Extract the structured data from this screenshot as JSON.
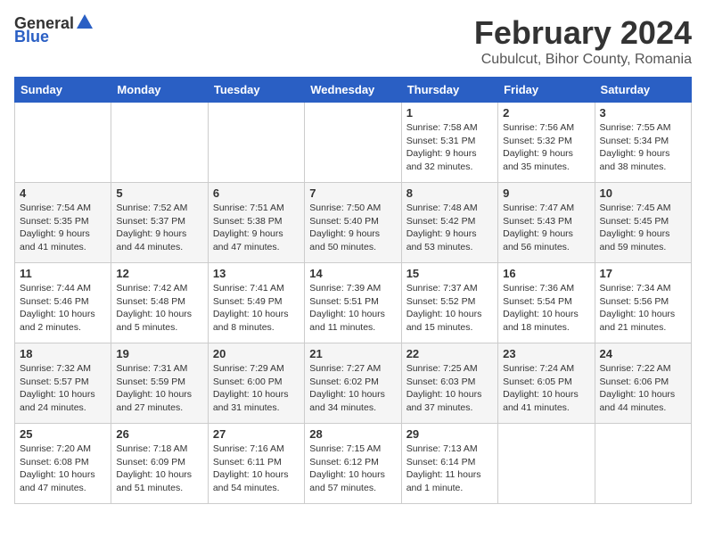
{
  "logo": {
    "general": "General",
    "blue": "Blue"
  },
  "title": "February 2024",
  "subtitle": "Cubulcut, Bihor County, Romania",
  "days_of_week": [
    "Sunday",
    "Monday",
    "Tuesday",
    "Wednesday",
    "Thursday",
    "Friday",
    "Saturday"
  ],
  "weeks": [
    [
      {
        "day": "",
        "info": ""
      },
      {
        "day": "",
        "info": ""
      },
      {
        "day": "",
        "info": ""
      },
      {
        "day": "",
        "info": ""
      },
      {
        "day": "1",
        "info": "Sunrise: 7:58 AM\nSunset: 5:31 PM\nDaylight: 9 hours\nand 32 minutes."
      },
      {
        "day": "2",
        "info": "Sunrise: 7:56 AM\nSunset: 5:32 PM\nDaylight: 9 hours\nand 35 minutes."
      },
      {
        "day": "3",
        "info": "Sunrise: 7:55 AM\nSunset: 5:34 PM\nDaylight: 9 hours\nand 38 minutes."
      }
    ],
    [
      {
        "day": "4",
        "info": "Sunrise: 7:54 AM\nSunset: 5:35 PM\nDaylight: 9 hours\nand 41 minutes."
      },
      {
        "day": "5",
        "info": "Sunrise: 7:52 AM\nSunset: 5:37 PM\nDaylight: 9 hours\nand 44 minutes."
      },
      {
        "day": "6",
        "info": "Sunrise: 7:51 AM\nSunset: 5:38 PM\nDaylight: 9 hours\nand 47 minutes."
      },
      {
        "day": "7",
        "info": "Sunrise: 7:50 AM\nSunset: 5:40 PM\nDaylight: 9 hours\nand 50 minutes."
      },
      {
        "day": "8",
        "info": "Sunrise: 7:48 AM\nSunset: 5:42 PM\nDaylight: 9 hours\nand 53 minutes."
      },
      {
        "day": "9",
        "info": "Sunrise: 7:47 AM\nSunset: 5:43 PM\nDaylight: 9 hours\nand 56 minutes."
      },
      {
        "day": "10",
        "info": "Sunrise: 7:45 AM\nSunset: 5:45 PM\nDaylight: 9 hours\nand 59 minutes."
      }
    ],
    [
      {
        "day": "11",
        "info": "Sunrise: 7:44 AM\nSunset: 5:46 PM\nDaylight: 10 hours\nand 2 minutes."
      },
      {
        "day": "12",
        "info": "Sunrise: 7:42 AM\nSunset: 5:48 PM\nDaylight: 10 hours\nand 5 minutes."
      },
      {
        "day": "13",
        "info": "Sunrise: 7:41 AM\nSunset: 5:49 PM\nDaylight: 10 hours\nand 8 minutes."
      },
      {
        "day": "14",
        "info": "Sunrise: 7:39 AM\nSunset: 5:51 PM\nDaylight: 10 hours\nand 11 minutes."
      },
      {
        "day": "15",
        "info": "Sunrise: 7:37 AM\nSunset: 5:52 PM\nDaylight: 10 hours\nand 15 minutes."
      },
      {
        "day": "16",
        "info": "Sunrise: 7:36 AM\nSunset: 5:54 PM\nDaylight: 10 hours\nand 18 minutes."
      },
      {
        "day": "17",
        "info": "Sunrise: 7:34 AM\nSunset: 5:56 PM\nDaylight: 10 hours\nand 21 minutes."
      }
    ],
    [
      {
        "day": "18",
        "info": "Sunrise: 7:32 AM\nSunset: 5:57 PM\nDaylight: 10 hours\nand 24 minutes."
      },
      {
        "day": "19",
        "info": "Sunrise: 7:31 AM\nSunset: 5:59 PM\nDaylight: 10 hours\nand 27 minutes."
      },
      {
        "day": "20",
        "info": "Sunrise: 7:29 AM\nSunset: 6:00 PM\nDaylight: 10 hours\nand 31 minutes."
      },
      {
        "day": "21",
        "info": "Sunrise: 7:27 AM\nSunset: 6:02 PM\nDaylight: 10 hours\nand 34 minutes."
      },
      {
        "day": "22",
        "info": "Sunrise: 7:25 AM\nSunset: 6:03 PM\nDaylight: 10 hours\nand 37 minutes."
      },
      {
        "day": "23",
        "info": "Sunrise: 7:24 AM\nSunset: 6:05 PM\nDaylight: 10 hours\nand 41 minutes."
      },
      {
        "day": "24",
        "info": "Sunrise: 7:22 AM\nSunset: 6:06 PM\nDaylight: 10 hours\nand 44 minutes."
      }
    ],
    [
      {
        "day": "25",
        "info": "Sunrise: 7:20 AM\nSunset: 6:08 PM\nDaylight: 10 hours\nand 47 minutes."
      },
      {
        "day": "26",
        "info": "Sunrise: 7:18 AM\nSunset: 6:09 PM\nDaylight: 10 hours\nand 51 minutes."
      },
      {
        "day": "27",
        "info": "Sunrise: 7:16 AM\nSunset: 6:11 PM\nDaylight: 10 hours\nand 54 minutes."
      },
      {
        "day": "28",
        "info": "Sunrise: 7:15 AM\nSunset: 6:12 PM\nDaylight: 10 hours\nand 57 minutes."
      },
      {
        "day": "29",
        "info": "Sunrise: 7:13 AM\nSunset: 6:14 PM\nDaylight: 11 hours\nand 1 minute."
      },
      {
        "day": "",
        "info": ""
      },
      {
        "day": "",
        "info": ""
      }
    ]
  ]
}
